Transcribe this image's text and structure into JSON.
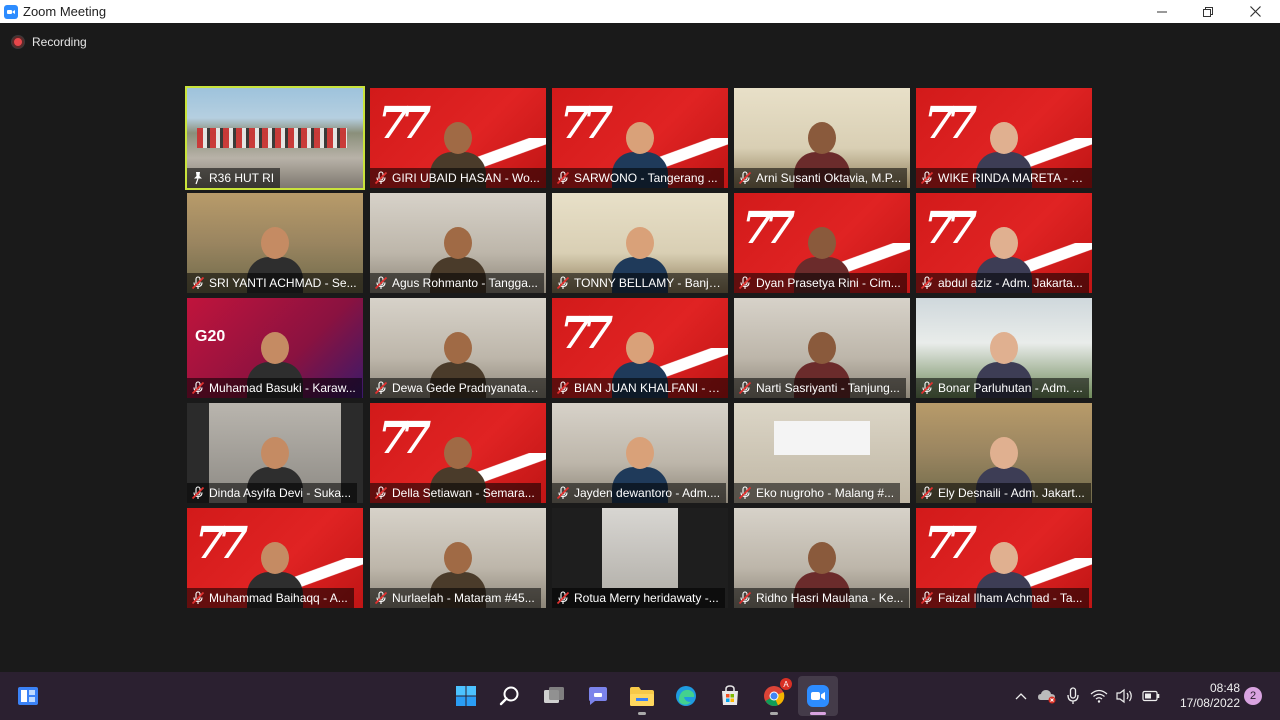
{
  "window": {
    "title": "Zoom Meeting",
    "minimize_icon": "minimize-icon",
    "maximize_icon": "restore-icon",
    "close_icon": "close-icon"
  },
  "recording": {
    "label": "Recording",
    "icon": "recording-dot-icon",
    "color": "#e8474b"
  },
  "active_speaker_color": "#c9e33b",
  "participants": [
    {
      "name": "R36 HUT RI",
      "muted": false,
      "pinned": true,
      "bg": "parade"
    },
    {
      "name": "GIRI UBAID HASAN - Wo...",
      "muted": true,
      "bg": "red77"
    },
    {
      "name": "SARWONO - Tangerang ...",
      "muted": true,
      "bg": "red77"
    },
    {
      "name": "Arni Susanti Oktavia, M.P...",
      "muted": true,
      "bg": "office"
    },
    {
      "name": "WIKE RINDA MARETA - M...",
      "muted": true,
      "bg": "red77"
    },
    {
      "name": "SRI YANTI ACHMAD - Se...",
      "muted": true,
      "bg": "garden"
    },
    {
      "name": "Agus Rohmanto - Tangga...",
      "muted": true,
      "bg": "room"
    },
    {
      "name": "TONNY BELLAMY - Banja...",
      "muted": true,
      "bg": "office"
    },
    {
      "name": "Dyan Prasetya Rini - Cim...",
      "muted": true,
      "bg": "red77"
    },
    {
      "name": "abdul aziz - Adm. Jakarta...",
      "muted": true,
      "bg": "red77"
    },
    {
      "name": "Muhamad Basuki - Karaw...",
      "muted": true,
      "bg": "g20"
    },
    {
      "name": "Dewa Gede Pradnyanata ...",
      "muted": true,
      "bg": "room"
    },
    {
      "name": "BIAN JUAN KHALFANI - A...",
      "muted": true,
      "bg": "red77"
    },
    {
      "name": "Narti Sasriyanti - Tanjung...",
      "muted": true,
      "bg": "room"
    },
    {
      "name": "Bonar Parluhutan - Adm. ...",
      "muted": true,
      "bg": "palace"
    },
    {
      "name": "Dinda Asyifa Devi - Suka...",
      "muted": true,
      "bg": "dark"
    },
    {
      "name": "Della Setiawan - Semara...",
      "muted": true,
      "bg": "red77"
    },
    {
      "name": "Jayden dewantoro - Adm....",
      "muted": true,
      "bg": "room"
    },
    {
      "name": "Eko nugroho - Malang #...",
      "muted": true,
      "bg": "banner"
    },
    {
      "name": "Ely Desnaili - Adm. Jakart...",
      "muted": true,
      "bg": "garden"
    },
    {
      "name": "Muhammad Baihaqq - A...",
      "muted": true,
      "bg": "red77"
    },
    {
      "name": "Nurlaelah - Mataram #45...",
      "muted": true,
      "bg": "room"
    },
    {
      "name": "Rotua Merry heridawaty -...",
      "muted": true,
      "bg": "door"
    },
    {
      "name": "Ridho Hasri Maulana - Ke...",
      "muted": true,
      "bg": "room"
    },
    {
      "name": "Faizal Ilham Achmad - Ta...",
      "muted": true,
      "bg": "red77"
    }
  ],
  "taskbar": {
    "start_icon": "windows-start-icon",
    "apps": [
      {
        "icon": "windows-start-icon",
        "active": false
      },
      {
        "icon": "search-icon",
        "active": false
      },
      {
        "icon": "task-view-icon",
        "active": false
      },
      {
        "icon": "teams-chat-icon",
        "active": false
      },
      {
        "icon": "file-explorer-icon",
        "active": false,
        "running": true
      },
      {
        "icon": "edge-browser-icon",
        "active": false
      },
      {
        "icon": "microsoft-store-icon",
        "active": false
      },
      {
        "icon": "chrome-icon",
        "active": false,
        "running": true,
        "badge": "A"
      },
      {
        "icon": "zoom-icon",
        "active": true,
        "running": true
      }
    ],
    "tray": [
      "chevron-up-icon",
      "onedrive-icon",
      "microphone-icon",
      "wifi-icon",
      "speaker-icon",
      "battery-icon"
    ],
    "time": "08:48",
    "date": "17/08/2022",
    "notification_count": "2"
  }
}
